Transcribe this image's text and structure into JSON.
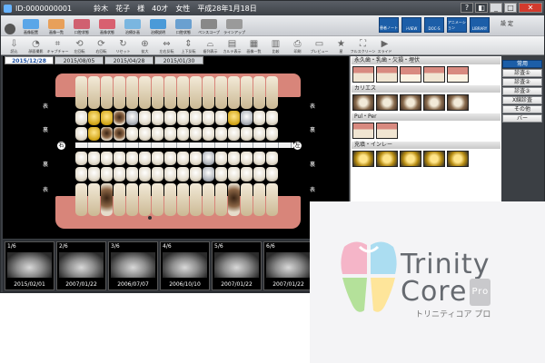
{
  "window": {
    "patient_id": "ID:0000000001",
    "patient_name_last": "鈴木",
    "patient_name_first": "花子",
    "honorific": "様",
    "age": "40才",
    "sex": "女性",
    "date": "平成28年1月18日"
  },
  "toolbar1": {
    "buttons": [
      {
        "label": "画像配置",
        "color": "#5aa6e8"
      },
      {
        "label": "画像一覧",
        "color": "#e8a05a"
      },
      {
        "label": "口腔状態",
        "color": "#d06070"
      },
      {
        "label": "画像状態",
        "color": "#d86070"
      },
      {
        "label": "治療計画",
        "color": "#7ab6e0"
      },
      {
        "label": "治療説明",
        "color": "#4a9ad8"
      },
      {
        "label": "口腔状態",
        "color": "#6aa0d0"
      },
      {
        "label": "ペンスコープ",
        "color": "#888888"
      },
      {
        "label": "ラインアップ",
        "color": "#9a9a9a"
      }
    ],
    "right_buttons": [
      "患者ノート",
      "i-VIEW",
      "DOC-S",
      "アニメーション",
      "LIBRARY"
    ],
    "user_labels": [
      "実 績",
      "設 定"
    ]
  },
  "toolbar2": {
    "buttons": [
      {
        "label": "読込",
        "icon": "download-icon"
      },
      {
        "label": "顔面撮影",
        "icon": "face-icon"
      },
      {
        "label": "キャプチャー",
        "icon": "capture-icon"
      },
      {
        "label": "左回転",
        "icon": "rotate-left-icon"
      },
      {
        "label": "右回転",
        "icon": "rotate-right-icon"
      },
      {
        "label": "リセット",
        "icon": "reset-icon"
      },
      {
        "label": "拡大",
        "icon": "zoom-in-icon"
      },
      {
        "label": "左右反転",
        "icon": "flip-icon"
      },
      {
        "label": "上下反転",
        "icon": "flip-vertical-icon"
      },
      {
        "label": "歯列表示",
        "icon": "teeth-icon"
      },
      {
        "label": "カルテ表示",
        "icon": "chart-icon"
      },
      {
        "label": "画像一覧",
        "icon": "list-icon"
      },
      {
        "label": "比較",
        "icon": "compare-icon"
      },
      {
        "label": "印刷",
        "icon": "print-icon"
      },
      {
        "label": "プレビュー",
        "icon": "preview-icon"
      },
      {
        "label": "星",
        "icon": "star-icon"
      },
      {
        "label": "フルスクリーン",
        "icon": "fullscreen-icon"
      },
      {
        "label": "スライド",
        "icon": "slide-icon"
      }
    ]
  },
  "tabs": [
    "2015/12/28",
    "2015/08/05",
    "2015/04/28",
    "2015/01/30"
  ],
  "chart": {
    "label_omote": "表",
    "label_ura": "裏",
    "label_right": "右",
    "label_left": "左"
  },
  "right_panel": {
    "sections": [
      {
        "title": "永久歯・乳歯・欠損・埋伏",
        "images": [
          "t1",
          "t1",
          "t3",
          "t1",
          "t3"
        ]
      },
      {
        "title": "カリエス",
        "images": [
          "t2",
          "t2",
          "t2",
          "t2",
          "t2"
        ]
      },
      {
        "title": "Pul・Per",
        "images": [
          "t1",
          "t1"
        ]
      },
      {
        "title": "充填・インレー",
        "images": [
          "t4",
          "t4",
          "t4",
          "t4",
          "t4"
        ]
      }
    ]
  },
  "side_buttons": [
    "常用",
    "診査①",
    "診査②",
    "診査③",
    "X線診査",
    "その他",
    "バー"
  ],
  "thumbnails": [
    {
      "num": "1/6",
      "date": "2015/02/01"
    },
    {
      "num": "2/6",
      "date": "2007/01/22"
    },
    {
      "num": "3/6",
      "date": "2006/07/07"
    },
    {
      "num": "4/6",
      "date": "2006/10/10"
    },
    {
      "num": "5/6",
      "date": "2007/01/22"
    },
    {
      "num": "6/6",
      "date": "2007/01/22"
    }
  ],
  "logo": {
    "line1": "Trinity",
    "line2": "Core",
    "pro": "Pro",
    "subtitle": "トリニティコア プロ"
  }
}
